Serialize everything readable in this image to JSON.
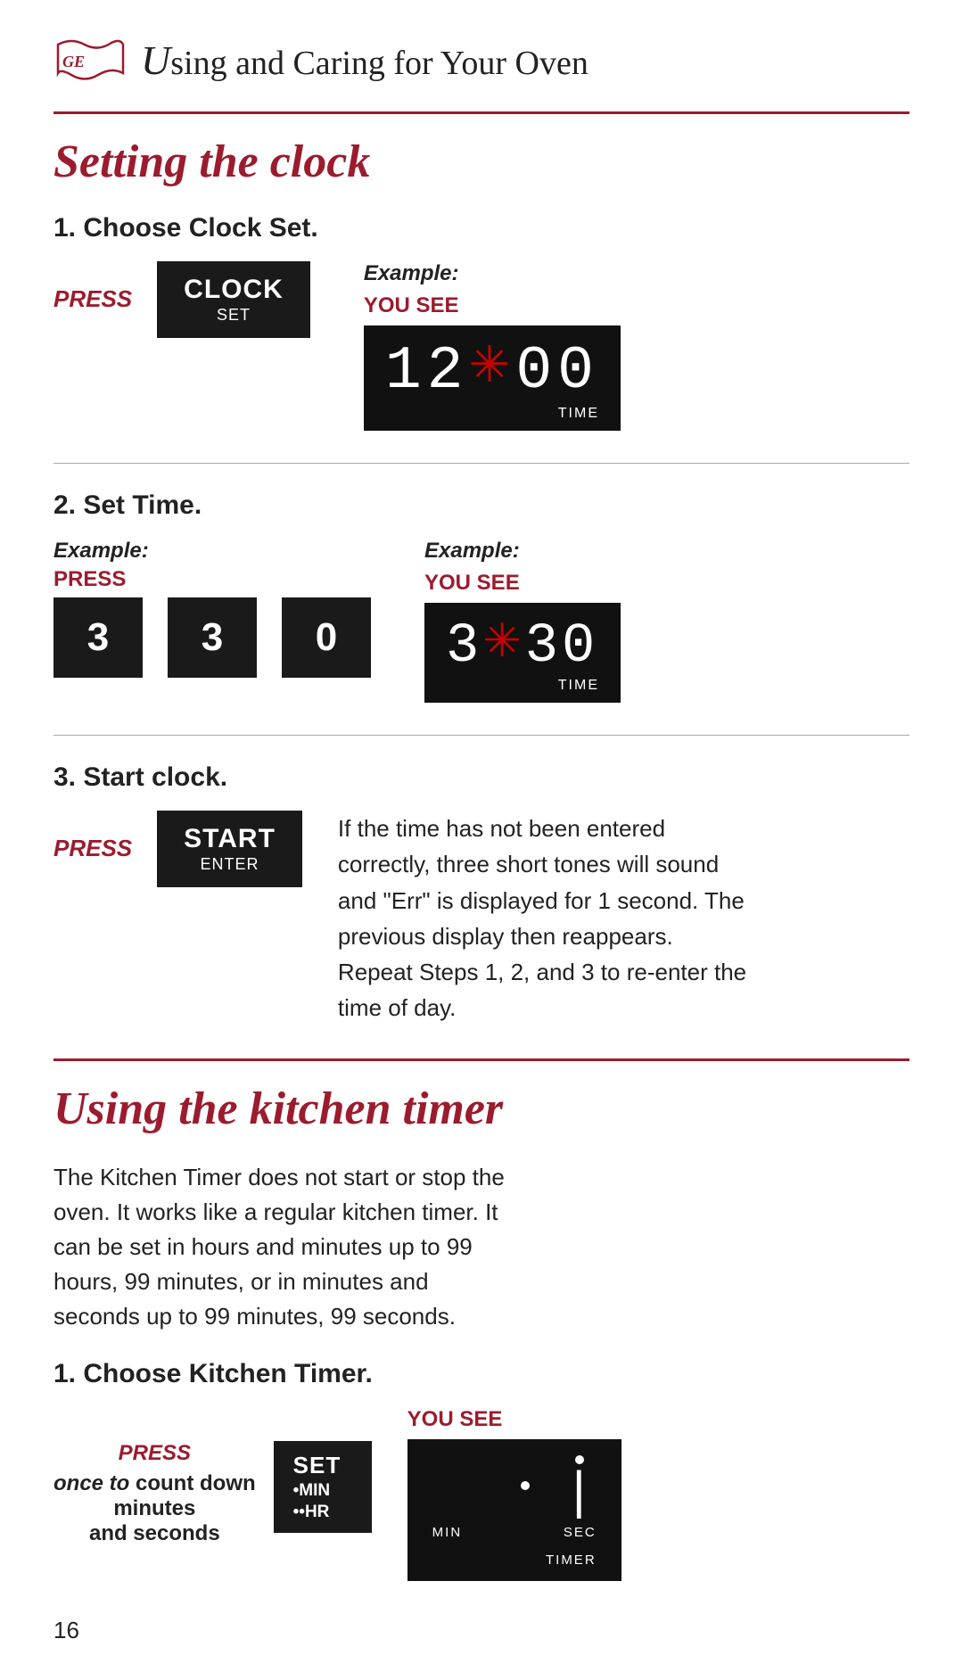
{
  "header": {
    "title_prefix": "sing and Caring for Your Oven",
    "u_letter": "U"
  },
  "section1": {
    "title": "Setting the clock",
    "step1": {
      "heading": "1. Choose Clock Set.",
      "press_label": "PRESS",
      "button_main": "CLOCK",
      "button_sub": "SET",
      "example_label": "Example:",
      "you_see_label": "YOU SEE",
      "display_text": "12:00",
      "display_label": "TIME"
    },
    "step2": {
      "heading": "2. Set Time.",
      "example_press_label": "Example:",
      "press_label": "PRESS",
      "buttons": [
        "3",
        "3",
        "0"
      ],
      "example_see_label": "Example:",
      "you_see_label": "YOU SEE",
      "display_text": "3:30",
      "display_label": "TIME"
    },
    "step3": {
      "heading": "3. Start clock.",
      "press_label": "PRESS",
      "button_main": "START",
      "button_sub": "ENTER",
      "info_text": "If the time has not been entered correctly, three short tones will sound and \"Err\" is displayed for 1 second. The previous display then reappears. Repeat Steps 1, 2, and 3 to re-enter the time of day."
    }
  },
  "section2": {
    "title": "Using the kitchen timer",
    "description": "The Kitchen Timer does not start or stop the oven. It works like a regular kitchen timer. It can be set in hours and minutes up to 99 hours, 99 minutes, or in minutes and seconds up to 99 minutes, 99 seconds.",
    "step1": {
      "heading": "1. Choose Kitchen Timer.",
      "press_label": "PRESS",
      "press_note": "once to",
      "press_note2": "count down",
      "press_note3": "minutes",
      "press_note4": "and seconds",
      "button_main": "SET",
      "button_sub1": "•MIN",
      "button_sub2": "••HR",
      "you_see_label": "YOU SEE",
      "display_min_label": "MIN",
      "display_sec_label": "SEC",
      "display_timer_label": "TIMER"
    }
  },
  "page_number": "16"
}
